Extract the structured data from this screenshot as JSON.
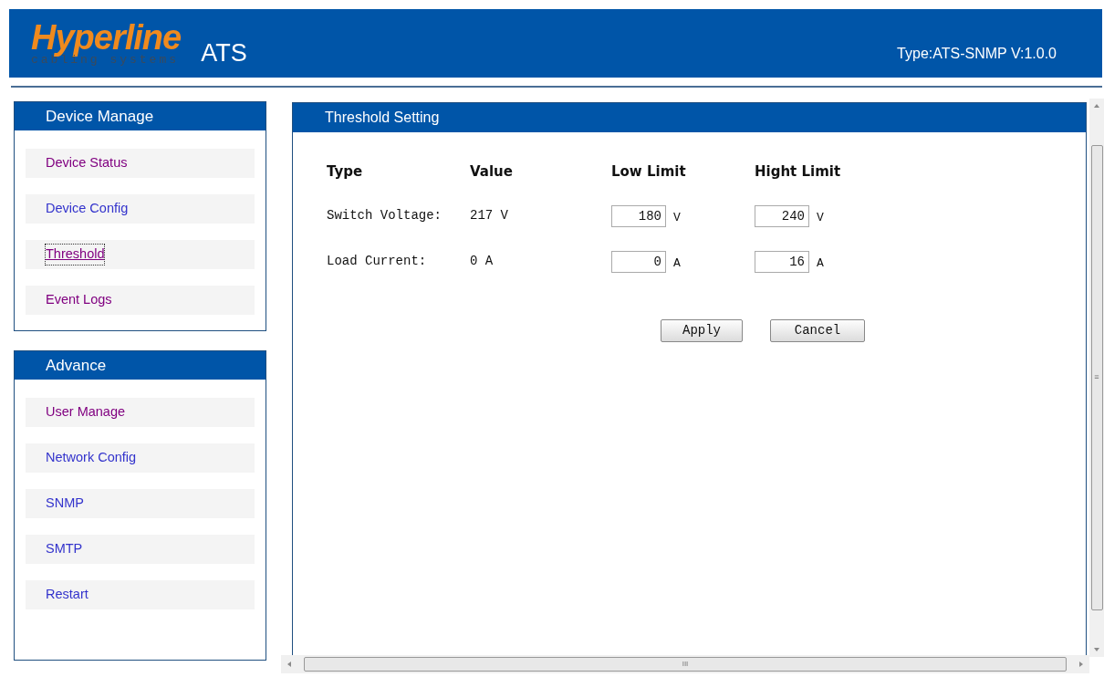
{
  "header": {
    "logo_name": "Hyperline",
    "logo_tagline": "cabling systems",
    "product": "ATS",
    "version": "Type:ATS-SNMP V:1.0.0"
  },
  "sidebar": [
    {
      "title": "Device Manage",
      "items": [
        {
          "label": "Device Status",
          "color": "#800080",
          "selected": false
        },
        {
          "label": "Device Config",
          "color": "#3333cc",
          "selected": false
        },
        {
          "label": "Threshold",
          "color": "#800080",
          "selected": true
        },
        {
          "label": "Event Logs",
          "color": "#800080",
          "selected": false
        }
      ]
    },
    {
      "title": "Advance",
      "items": [
        {
          "label": "User Manage",
          "color": "#800080",
          "selected": false
        },
        {
          "label": "Network Config",
          "color": "#3333cc",
          "selected": false
        },
        {
          "label": "SNMP",
          "color": "#3333cc",
          "selected": false
        },
        {
          "label": "SMTP",
          "color": "#3333cc",
          "selected": false
        },
        {
          "label": "Restart",
          "color": "#3333cc",
          "selected": false
        }
      ]
    }
  ],
  "panel": {
    "title": "Threshold Setting",
    "columns": [
      "Type",
      "Value",
      "Low Limit",
      "Hight Limit"
    ],
    "rows": [
      {
        "type": "Switch Voltage:",
        "value": "217 V",
        "low": "180",
        "low_unit": "V",
        "high": "240",
        "high_unit": "V"
      },
      {
        "type": "Load Current:",
        "value": "0 A",
        "low": "0",
        "low_unit": "A",
        "high": "16",
        "high_unit": "A"
      }
    ],
    "buttons": [
      "Apply",
      "Cancel"
    ]
  },
  "scrollbar": {
    "thumb_glyph": "III",
    "side_glyph": "≡"
  }
}
